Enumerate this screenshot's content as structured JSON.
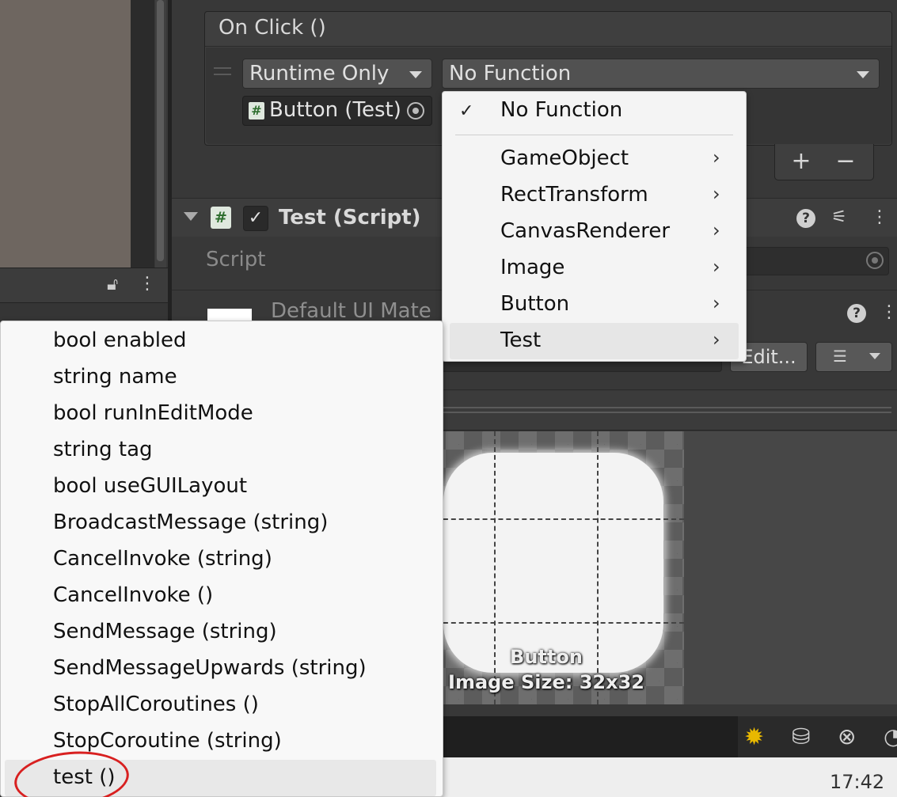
{
  "inspector": {
    "on_click_title": "On Click ()",
    "runtime_dropdown": "Runtime Only",
    "function_dropdown": "No Function",
    "object_field": "Button (Test)",
    "add_button": "+",
    "remove_button": "−",
    "component_title": "Test (Script)",
    "script_label": "Script",
    "material_title": "Default UI Mate",
    "edit_button": "Edit..."
  },
  "function_menu": {
    "items": [
      {
        "label": "No Function",
        "checked": true
      },
      {
        "label": "GameObject",
        "submenu": true
      },
      {
        "label": "RectTransform",
        "submenu": true
      },
      {
        "label": "CanvasRenderer",
        "submenu": true
      },
      {
        "label": "Image",
        "submenu": true
      },
      {
        "label": "Button",
        "submenu": true
      },
      {
        "label": "Test",
        "submenu": true,
        "highlighted": true
      }
    ]
  },
  "method_menu": {
    "items": [
      "bool enabled",
      "string name",
      "bool runInEditMode",
      "string tag",
      "bool useGUILayout",
      "BroadcastMessage (string)",
      "CancelInvoke (string)",
      "CancelInvoke ()",
      "SendMessage (string)",
      "SendMessageUpwards (string)",
      "StopAllCoroutines ()",
      "StopCoroutine (string)",
      "test ()"
    ],
    "highlighted_item": "test ()"
  },
  "preview": {
    "name": "Button",
    "size": "Image Size: 32x32"
  },
  "taskbar": {
    "clock": "17:42"
  },
  "icons": {
    "check": "✓",
    "submenu_arrow": "›",
    "lock": "lock-icon",
    "bug": "bug-icon",
    "database": "database-icon",
    "network": "network-icon"
  }
}
